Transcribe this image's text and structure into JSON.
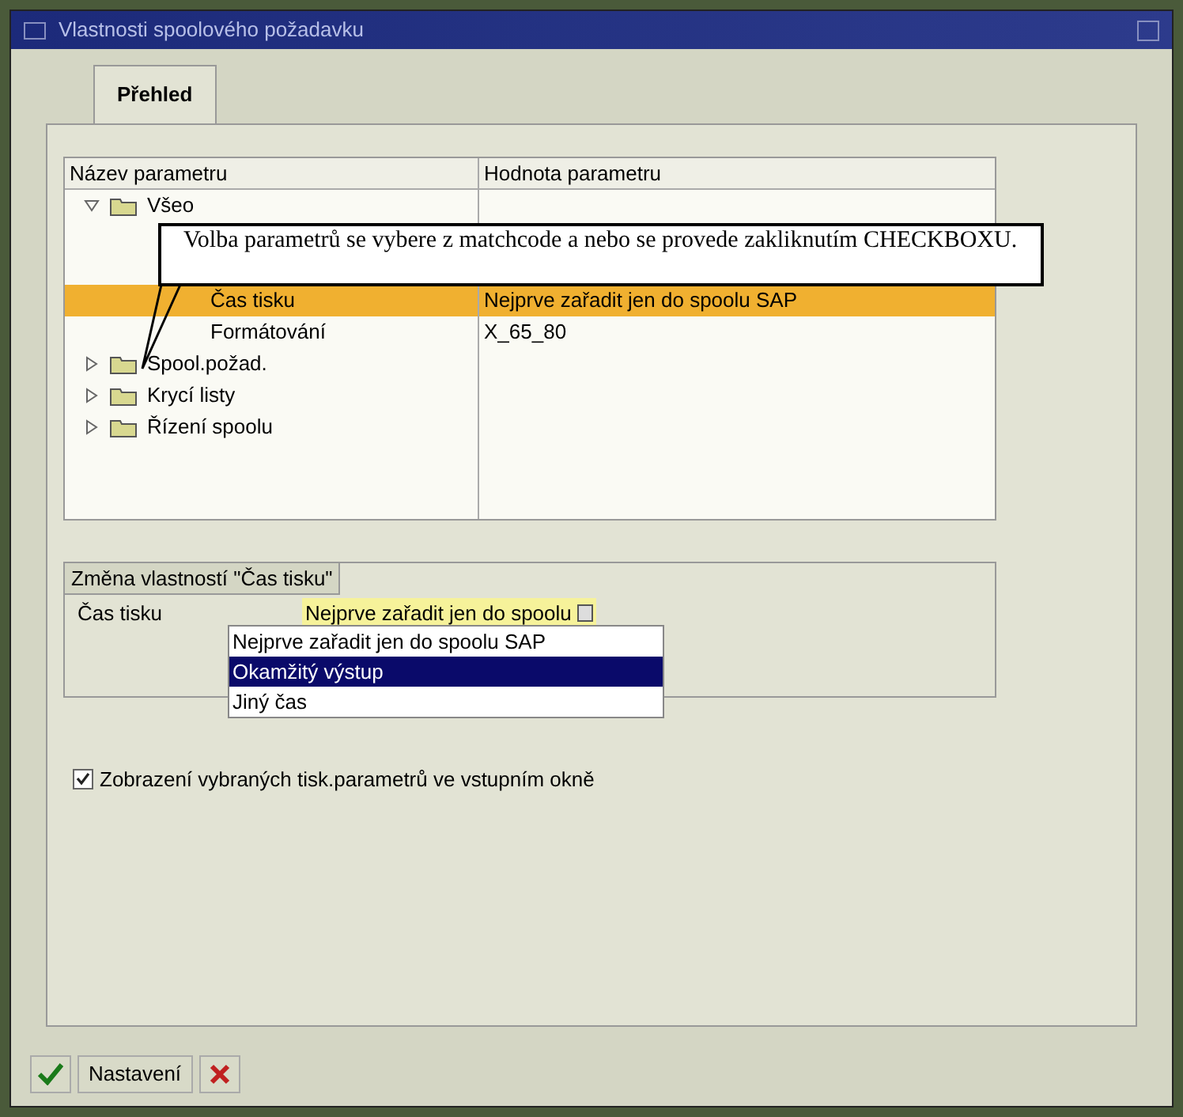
{
  "window": {
    "title": "Vlastnosti spoolového požadavku"
  },
  "tabs": [
    {
      "label": "Přehled",
      "selected": true
    }
  ],
  "tree": {
    "columns": [
      "Název parametru",
      "Hodnota parametru"
    ],
    "rows": [
      {
        "label": "Všeo",
        "expanded": true,
        "selected": false,
        "children": [
          {
            "selected": false
          },
          {
            "selected": false
          },
          {
            "label": "Čas tisku",
            "value": "Nejprve zařadit jen do spoolu SAP",
            "selected": true
          },
          {
            "label": "Formátování",
            "value": "X_65_80",
            "selected": false
          }
        ]
      },
      {
        "label": "Spool.požad.",
        "expanded": false,
        "selected": false
      },
      {
        "label": "Krycí listy",
        "expanded": false,
        "selected": false
      },
      {
        "label": "Řízení spoolu",
        "expanded": false,
        "selected": false
      }
    ]
  },
  "callout": {
    "text": "Volba parametrů se vybere z matchcode a nebo se provede zakliknutím CHECKBOXU."
  },
  "group": {
    "title": "Změna vlastností \"Čas tisku\"",
    "field_label": "Čas tisku",
    "field_value": "Nejprve zařadit jen do spoolu",
    "options": [
      {
        "label": "Nejprve zařadit jen do spoolu SAP",
        "selected": false
      },
      {
        "label": "Okamžitý výstup",
        "selected": true
      },
      {
        "label": "Jiný čas",
        "selected": false
      }
    ]
  },
  "checkbox": {
    "label": "Zobrazení vybraných tisk.parametrů ve vstupním okně",
    "checked": true
  },
  "buttons": [
    {
      "kind": "confirm"
    },
    {
      "kind": "text",
      "label": "Nastavení"
    },
    {
      "kind": "cancel"
    }
  ]
}
